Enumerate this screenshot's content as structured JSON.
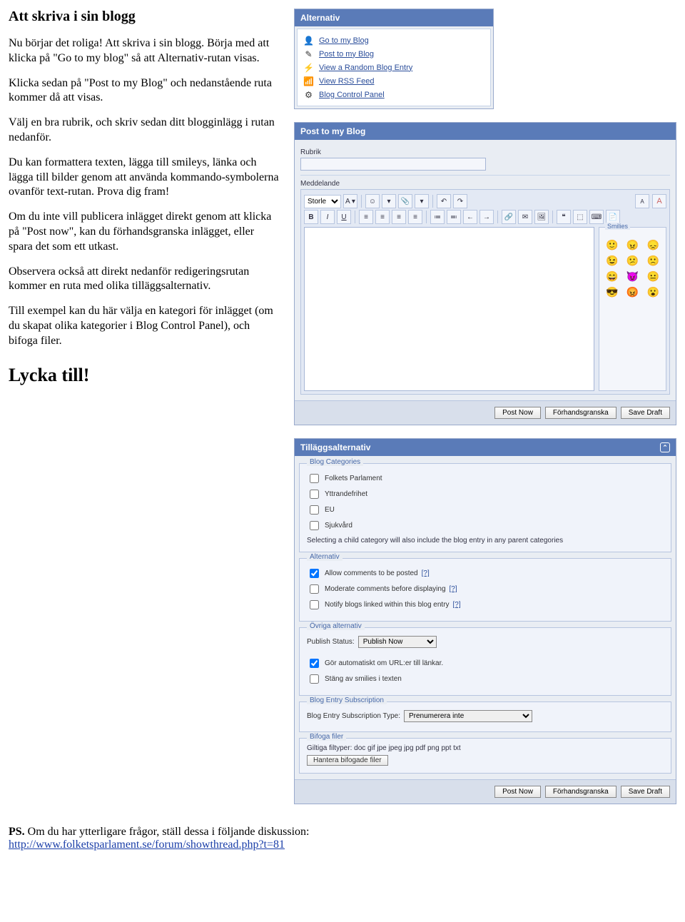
{
  "doc": {
    "heading": "Att skriva i sin blogg",
    "p1": "Nu börjar det roliga! Att skriva i sin blogg. Börja med att klicka på \"Go to my blog\" så att Alternativ-rutan visas.",
    "p2": "Klicka sedan på \"Post to my Blog\" och nedanstående ruta kommer då att visas.",
    "p3": "Välj en bra rubrik, och skriv sedan ditt blogginlägg i rutan nedanför.",
    "p4": "Du kan formattera texten, lägga till smileys, länka och lägga till bilder genom att använda kommando-symbolerna ovanför text-rutan. Prova dig fram!",
    "p5": "Om du inte vill publicera inlägget direkt genom att klicka på \"Post now\", kan du förhandsgranska inlägget, eller spara det som ett utkast.",
    "p6": "Observera också att direkt nedanför redigeringsrutan kommer en ruta med olika tilläggsalternativ.",
    "p7": "Till exempel kan du här välja en kategori för inlägget (om du skapat olika kategorier i Blog Control Panel), och bifoga filer.",
    "bigheading": "Lycka till!",
    "ps_prefix": "PS.",
    "ps_text": " Om du har ytterligare frågor, ställ dessa i följande diskussion: ",
    "ps_link": "http://www.folketsparlament.se/forum/showthread.php?t=81"
  },
  "alternativ": {
    "title": "Alternativ",
    "items": [
      {
        "label": "Go to my Blog",
        "icon": "👤"
      },
      {
        "label": "Post to my Blog",
        "icon": "✎"
      },
      {
        "label": "View a Random Blog Entry",
        "icon": "⚡"
      },
      {
        "label": "View RSS Feed",
        "icon": "📶"
      },
      {
        "label": "Blog Control Panel",
        "icon": "⚙"
      }
    ]
  },
  "editor": {
    "title": "Post to my Blog",
    "rubrik_label": "Rubrik",
    "meddelande_label": "Meddelande",
    "font_select": "Storle",
    "toolbar_row1": [
      "A ▾",
      "☺",
      "▾",
      "📎",
      "▾",
      "↶",
      "↷"
    ],
    "toolbar_row2_bold": "B",
    "toolbar_row2_italic": "I",
    "toolbar_row2_under": "U",
    "toolbar_row2_misc": [
      "≡",
      "≡",
      "≡",
      "≡",
      "≔",
      "≕",
      "←",
      "→",
      "🔗",
      "✉",
      "🖼",
      "❝",
      "⬚",
      "⌨",
      "📄"
    ],
    "aa1": "A",
    "aa2": "A",
    "smilies_title": "Smilies",
    "smilies": [
      "🙂",
      "😠",
      "😞",
      "😉",
      "😕",
      "🙁",
      "😄",
      "😈",
      "😐",
      "😎",
      "😡",
      "😮"
    ],
    "btn_post": "Post Now",
    "btn_preview": "Förhandsgranska",
    "btn_draft": "Save Draft"
  },
  "options": {
    "title": "Tilläggsalternativ",
    "categories": {
      "legend": "Blog Categories",
      "items": [
        "Folkets Parlament",
        "Yttrandefrihet",
        "EU",
        "Sjukvård"
      ],
      "note": "Selecting a child category will also include the blog entry in any parent categories"
    },
    "alternativ": {
      "legend": "Alternativ",
      "items": [
        "Allow comments to be posted",
        "Moderate comments before displaying",
        "Notify blogs linked within this blog entry"
      ],
      "q": "[?]"
    },
    "ovriga": {
      "legend": "Övriga alternativ",
      "publish_label": "Publish Status:",
      "publish_value": "Publish Now",
      "items": [
        "Gör automatiskt om URL:er till länkar.",
        "Stäng av smilies i texten"
      ]
    },
    "subscription": {
      "legend": "Blog Entry Subscription",
      "label": "Blog Entry Subscription Type:",
      "value": "Prenumerera inte"
    },
    "attach": {
      "legend": "Bifoga filer",
      "note": "Giltiga filtyper: doc gif jpe jpeg jpg pdf png ppt txt",
      "btn": "Hantera bifogade filer"
    },
    "btn_post": "Post Now",
    "btn_preview": "Förhandsgranska",
    "btn_draft": "Save Draft"
  }
}
